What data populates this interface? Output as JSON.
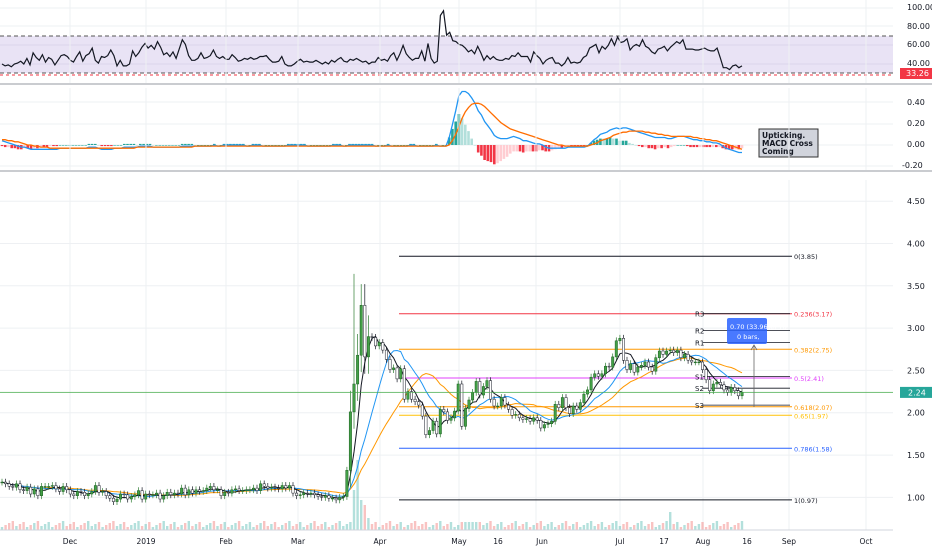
{
  "chart_data": [
    {
      "type": "line",
      "panel": "rsi",
      "ylim": [
        20,
        100
      ],
      "yticks": [
        "100.00",
        "80.00",
        "60.00",
        "40.00"
      ],
      "band_upper": 70,
      "band_lower": 30,
      "last_value_label": "33.26",
      "series": [
        {
          "values": [
            40,
            38,
            39,
            37,
            40,
            41,
            43,
            40,
            46,
            39,
            52,
            47,
            44,
            50,
            42,
            47,
            45,
            39,
            44,
            49,
            50,
            48,
            44,
            42,
            48,
            53,
            43,
            49,
            51,
            57,
            44,
            41,
            48,
            47,
            49,
            55,
            49,
            38,
            44,
            38,
            38,
            40,
            54,
            48,
            52,
            58,
            62,
            57,
            60,
            56,
            64,
            58,
            50,
            52,
            48,
            53,
            46,
            56,
            66,
            61,
            49,
            44,
            44,
            46,
            52,
            46,
            47,
            49,
            55,
            48,
            46,
            48,
            45,
            45,
            50,
            47,
            43,
            44,
            46,
            45,
            47,
            45,
            46,
            48,
            48,
            49,
            45,
            42,
            42,
            43,
            48,
            40,
            38,
            38,
            40,
            43,
            45,
            42,
            43,
            42,
            42,
            44,
            42,
            40,
            42,
            40,
            44,
            42,
            45,
            47,
            43,
            42,
            45,
            44,
            46,
            44,
            42,
            43,
            40,
            42,
            42,
            47,
            44,
            45,
            43,
            49,
            52,
            44,
            51,
            60,
            51,
            47,
            44,
            46,
            46,
            54,
            43,
            62,
            46,
            41,
            43,
            92,
            97,
            71,
            74,
            65,
            64,
            61,
            60,
            57,
            53,
            55,
            51,
            59,
            52,
            44,
            49,
            45,
            48,
            45,
            44,
            44,
            46,
            45,
            49,
            48,
            52,
            48,
            48,
            48,
            42,
            53,
            49,
            46,
            40,
            44,
            46,
            47,
            41,
            41,
            38,
            41,
            47,
            41,
            42,
            41,
            42,
            47,
            49,
            57,
            59,
            61,
            52,
            59,
            56,
            60,
            67,
            60,
            69,
            63,
            64,
            67,
            55,
            59,
            61,
            59,
            66,
            59,
            57,
            53,
            51,
            56,
            57,
            59,
            54,
            58,
            61,
            64,
            62,
            66,
            56,
            56,
            56,
            55,
            55,
            56,
            57,
            55,
            54,
            54,
            57,
            47,
            36,
            36,
            34,
            38,
            39,
            36,
            38
          ]
        }
      ]
    },
    {
      "type": "line",
      "panel": "macd",
      "ylim": [
        -0.2,
        0.55
      ],
      "yticks": [
        "0.40",
        "0.20",
        "0.00",
        "-0.20"
      ],
      "annotation": "Upticking.\nMACD Cross\nComing",
      "series": [
        {
          "values": [
            0.04,
            0.03,
            0.02,
            0.01,
            0.0,
            -0.01,
            -0.02,
            -0.02,
            -0.03,
            -0.04,
            -0.04,
            -0.04,
            -0.04,
            -0.04,
            -0.04,
            -0.04,
            -0.04,
            -0.04,
            -0.03,
            -0.03,
            -0.03,
            -0.03,
            -0.03,
            -0.03,
            -0.03,
            -0.03,
            -0.03,
            -0.02,
            -0.02,
            -0.02,
            -0.03,
            -0.04,
            -0.04,
            -0.04,
            -0.04,
            -0.03,
            -0.03,
            -0.03,
            -0.02,
            -0.02,
            -0.02,
            -0.02,
            -0.02,
            -0.01,
            -0.01,
            -0.01,
            -0.01,
            -0.02,
            -0.02,
            -0.02,
            -0.02,
            -0.02,
            -0.02,
            -0.02,
            -0.02,
            -0.02,
            -0.01,
            -0.01,
            -0.01,
            -0.01,
            -0.01,
            -0.01,
            -0.01,
            -0.01,
            -0.01,
            -0.01,
            0.0,
            -0.01,
            -0.01,
            0.0,
            0.0,
            0.0,
            0.0,
            0.0,
            0.0,
            0.0,
            -0.01,
            -0.01,
            0.0,
            0.0,
            0.0,
            -0.01,
            -0.01,
            -0.01,
            -0.01,
            -0.01,
            -0.01,
            -0.01,
            -0.01,
            0.0,
            0.0,
            0.0,
            0.0,
            0.0,
            0.0,
            -0.01,
            -0.01,
            -0.01,
            -0.01,
            -0.01,
            -0.01,
            -0.01,
            -0.01,
            0.0,
            0.0,
            0.0,
            -0.01,
            -0.01,
            0.0,
            0.0,
            0.0,
            0.0,
            0.0,
            0.0,
            0.0,
            0.0,
            -0.01,
            -0.01,
            -0.01,
            -0.01,
            0.0,
            -0.01,
            -0.01,
            -0.01,
            -0.01,
            -0.01,
            -0.01,
            0.0,
            0.0,
            -0.01,
            -0.01,
            -0.01,
            -0.01,
            -0.01,
            -0.01,
            0.0,
            -0.01,
            -0.01,
            -0.01,
            0.07,
            0.19,
            0.32,
            0.46,
            0.5,
            0.5,
            0.48,
            0.44,
            0.39,
            0.32,
            0.28,
            0.22,
            0.18,
            0.14,
            0.09,
            0.07,
            0.06,
            0.06,
            0.06,
            0.07,
            0.08,
            0.07,
            0.06,
            0.04,
            0.04,
            0.03,
            0.02,
            0.01,
            0.01,
            0.0,
            -0.02,
            -0.03,
            -0.03,
            -0.03,
            -0.03,
            -0.03,
            -0.03,
            -0.02,
            -0.02,
            -0.02,
            -0.02,
            -0.02,
            -0.02,
            -0.01,
            0.02,
            0.05,
            0.07,
            0.1,
            0.11,
            0.12,
            0.14,
            0.15,
            0.16,
            0.15,
            0.16,
            0.16,
            0.15,
            0.14,
            0.13,
            0.12,
            0.11,
            0.1,
            0.09,
            0.08,
            0.07,
            0.07,
            0.07,
            0.07,
            0.06,
            0.06,
            0.07,
            0.08,
            0.08,
            0.08,
            0.07,
            0.06,
            0.05,
            0.05,
            0.04,
            0.04,
            0.03,
            0.03,
            0.02,
            0.02,
            0.01,
            -0.01,
            -0.03,
            -0.04,
            -0.05,
            -0.06,
            -0.07,
            -0.07
          ]
        },
        {
          "values": [
            0.05,
            0.05,
            0.04,
            0.04,
            0.03,
            0.03,
            0.02,
            0.01,
            0.0,
            0.0,
            -0.01,
            -0.01,
            -0.02,
            -0.02,
            -0.02,
            -0.03,
            -0.03,
            -0.03,
            -0.03,
            -0.03,
            -0.03,
            -0.03,
            -0.03,
            -0.03,
            -0.03,
            -0.03,
            -0.03,
            -0.03,
            -0.03,
            -0.03,
            -0.03,
            -0.03,
            -0.03,
            -0.03,
            -0.03,
            -0.03,
            -0.03,
            -0.03,
            -0.03,
            -0.03,
            -0.03,
            -0.03,
            -0.02,
            -0.02,
            -0.02,
            -0.02,
            -0.02,
            -0.02,
            -0.02,
            -0.02,
            -0.02,
            -0.02,
            -0.02,
            -0.02,
            -0.02,
            -0.02,
            -0.02,
            -0.02,
            -0.02,
            -0.02,
            -0.01,
            -0.01,
            -0.01,
            -0.01,
            -0.01,
            -0.01,
            -0.01,
            -0.01,
            -0.01,
            -0.01,
            -0.01,
            -0.01,
            -0.01,
            -0.01,
            -0.01,
            -0.01,
            -0.01,
            -0.01,
            -0.01,
            -0.01,
            -0.01,
            -0.01,
            -0.01,
            -0.01,
            -0.01,
            -0.01,
            -0.01,
            -0.01,
            -0.01,
            -0.01,
            -0.01,
            -0.01,
            -0.01,
            -0.01,
            -0.01,
            -0.01,
            -0.01,
            -0.01,
            -0.01,
            -0.01,
            -0.01,
            -0.01,
            -0.01,
            -0.01,
            -0.01,
            -0.01,
            -0.01,
            -0.01,
            -0.01,
            -0.01,
            -0.01,
            -0.01,
            -0.01,
            -0.01,
            -0.01,
            -0.01,
            -0.01,
            -0.01,
            -0.01,
            -0.01,
            -0.01,
            -0.01,
            -0.01,
            -0.01,
            -0.01,
            -0.01,
            -0.01,
            -0.01,
            -0.01,
            -0.01,
            -0.01,
            -0.01,
            -0.01,
            -0.01,
            -0.01,
            -0.01,
            -0.01,
            -0.01,
            -0.01,
            0.0,
            0.04,
            0.1,
            0.17,
            0.25,
            0.31,
            0.35,
            0.38,
            0.39,
            0.39,
            0.38,
            0.36,
            0.33,
            0.3,
            0.27,
            0.24,
            0.21,
            0.19,
            0.17,
            0.15,
            0.14,
            0.13,
            0.12,
            0.11,
            0.1,
            0.09,
            0.08,
            0.07,
            0.06,
            0.05,
            0.04,
            0.03,
            0.02,
            0.01,
            0.0,
            0.0,
            -0.01,
            -0.01,
            -0.01,
            -0.01,
            -0.01,
            -0.01,
            -0.01,
            -0.01,
            0.0,
            0.01,
            0.02,
            0.04,
            0.05,
            0.06,
            0.07,
            0.09,
            0.1,
            0.11,
            0.12,
            0.12,
            0.13,
            0.13,
            0.13,
            0.13,
            0.13,
            0.12,
            0.12,
            0.11,
            0.11,
            0.1,
            0.1,
            0.09,
            0.09,
            0.08,
            0.08,
            0.08,
            0.08,
            0.08,
            0.08,
            0.08,
            0.07,
            0.07,
            0.06,
            0.06,
            0.05,
            0.05,
            0.04,
            0.04,
            0.03,
            0.02,
            0.01,
            0.0,
            -0.01,
            -0.02,
            -0.03,
            -0.04
          ]
        }
      ]
    },
    {
      "type": "line",
      "panel": "price",
      "ylim": [
        0.65,
        4.75
      ],
      "yticks": [
        "4.50",
        "4.00",
        "3.50",
        "3.00",
        "2.50",
        "2.00",
        "1.50",
        "1.00"
      ],
      "categories": [
        "Dec",
        "2019",
        "Feb",
        "Mar",
        "Apr",
        "May",
        "16",
        "Jun",
        "Jul",
        "17",
        "Aug",
        "16",
        "Sep",
        "Oct"
      ],
      "last_price_label": "2.24",
      "fib_levels": [
        {
          "label": "0(3.85)",
          "value": 3.85,
          "color": "#131722"
        },
        {
          "label": "0.236(3.17)",
          "value": 3.17,
          "color": "#f23645"
        },
        {
          "label": "0.382(2.75)",
          "value": 2.75,
          "color": "#ff9800"
        },
        {
          "label": "0.5(2.41)",
          "value": 2.41,
          "color": "#e040fb"
        },
        {
          "label": "0.618(2.07)",
          "value": 2.07,
          "color": "#ff9800"
        },
        {
          "label": "0.65(1.97)",
          "value": 1.97,
          "color": "#ffc107"
        },
        {
          "label": "0.786(1.58)",
          "value": 1.58,
          "color": "#2962ff"
        },
        {
          "label": "1(0.97)",
          "value": 0.97,
          "color": "#131722"
        }
      ],
      "pivot_levels": [
        {
          "label": "R3",
          "value": 3.17
        },
        {
          "label": "R2",
          "value": 2.97
        },
        {
          "label": "R1",
          "value": 2.83
        },
        {
          "label": "S1",
          "value": 2.43
        },
        {
          "label": "S2",
          "value": 2.29
        },
        {
          "label": "S3",
          "value": 2.09
        }
      ],
      "measure_box": [
        "0.70 (33.96%) 70",
        "0 bars,"
      ],
      "series": [
        {
          "values": [
            1.18,
            1.16,
            1.13,
            1.12,
            1.16,
            1.09,
            1.08,
            1.12,
            1.04,
            1.1,
            1.02,
            1.13,
            1.13,
            1.13,
            1.14,
            1.1,
            1.07,
            1.13,
            1.09,
            1.04,
            1.02,
            1.07,
            1.06,
            1.02,
            1.04,
            1.07,
            1.14,
            1.06,
            1.07,
            1.02,
            0.99,
            0.95,
            0.98,
            1.04,
            1.03,
            0.98,
            1.01,
            1.03,
            1.08,
            0.98,
            1.04,
            1.03,
            1.03,
            1.05,
            0.98,
            1.02,
            1.06,
            1.03,
            1.05,
            1.04,
            1.11,
            1.03,
            1.09,
            1.05,
            1.09,
            1.07,
            1.08,
            1.11,
            1.13,
            1.09,
            1.09,
            1.02,
            1.06,
            1.05,
            1.09,
            1.1,
            1.08,
            1.08,
            1.09,
            1.09,
            1.11,
            1.08,
            1.16,
            1.13,
            1.11,
            1.12,
            1.11,
            1.1,
            1.14,
            1.11,
            1.14,
            1.05,
            1.02,
            1.03,
            1.05,
            1.04,
            1.05,
            1.03,
            1.01,
            1.0,
            1.02,
            0.99,
            0.99,
            0.97,
            1.0,
            1.01,
            1.32,
            2.01,
            2.34,
            2.68,
            3.27,
            2.66,
            2.9,
            2.89,
            2.79,
            2.83,
            2.74,
            2.63,
            2.51,
            2.53,
            2.4,
            2.52,
            2.16,
            2.25,
            2.16,
            2.13,
            2.09,
            1.96,
            1.74,
            1.79,
            1.9,
            1.75,
            2.04,
            2.01,
            1.91,
            1.94,
            2.02,
            2.34,
            1.84,
            2.05,
            2.15,
            2.24,
            2.37,
            2.21,
            2.31,
            2.38,
            2.16,
            2.08,
            2.08,
            2.18,
            2.09,
            2.04,
            1.97,
            1.98,
            1.94,
            1.92,
            1.93,
            1.9,
            1.94,
            1.91,
            1.82,
            1.86,
            1.87,
            1.9,
            2.1,
            2.06,
            2.18,
            2.06,
            1.99,
            2.08,
            2.04,
            2.12,
            2.22,
            2.27,
            2.42,
            2.46,
            2.43,
            2.46,
            2.55,
            2.54,
            2.66,
            2.85,
            2.88,
            2.62,
            2.51,
            2.58,
            2.48,
            2.54,
            2.56,
            2.6,
            2.54,
            2.49,
            2.65,
            2.73,
            2.69,
            2.73,
            2.74,
            2.71,
            2.74,
            2.65,
            2.69,
            2.62,
            2.6,
            2.6,
            2.6,
            2.51,
            2.39,
            2.26,
            2.34,
            2.36,
            2.33,
            2.27,
            2.24,
            2.3,
            2.26,
            2.2,
            2.24
          ]
        }
      ]
    }
  ]
}
